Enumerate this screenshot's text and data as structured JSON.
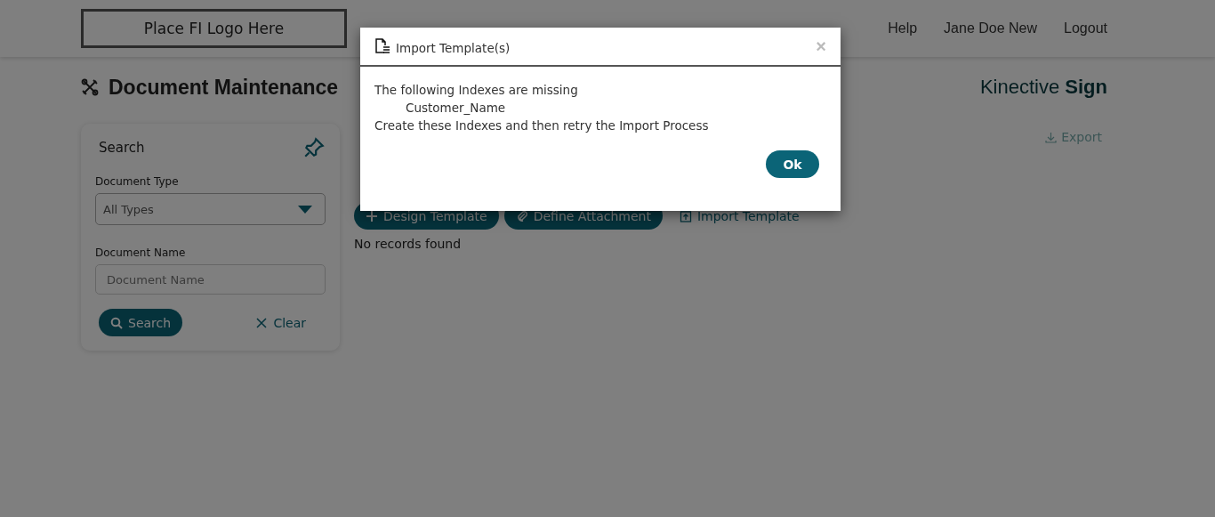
{
  "header": {
    "logo": "Place FI Logo Here",
    "nav": [
      {
        "label": "Help"
      },
      {
        "label": "Jane Doe New"
      },
      {
        "label": "Logout"
      }
    ]
  },
  "page": {
    "title": "Document Maintenance",
    "brand_light": "Kinective",
    "brand_bold": "Sign"
  },
  "search_panel": {
    "title": "Search",
    "document_type_label": "Document Type",
    "document_type_value": "All Types",
    "document_name_label": "Document Name",
    "document_name_placeholder": "Document Name",
    "search_button": "Search",
    "clear_button": "Clear"
  },
  "toolbar": {
    "export": "Export",
    "buttons": [
      {
        "label": "Design Template",
        "kind": "plus"
      },
      {
        "label": "Define Attachment",
        "kind": "clip"
      },
      {
        "label": "Import Template",
        "kind": "import"
      }
    ],
    "empty_message": "No records found"
  },
  "dialog": {
    "title": "Import Template(s)",
    "close": "×",
    "lines": [
      {
        "text": "The following Indexes are missing",
        "kind": "plain"
      },
      {
        "text": "Customer_Name",
        "kind": "indent"
      },
      {
        "text": "Create these Indexes and then retry the Import Process",
        "kind": "plain"
      }
    ],
    "ok_button": "Ok"
  }
}
